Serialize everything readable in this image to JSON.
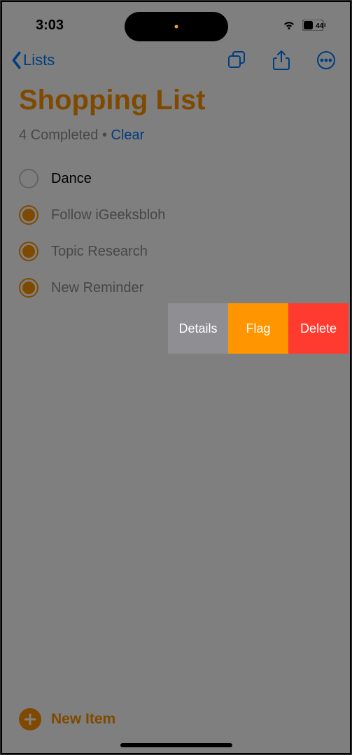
{
  "status": {
    "time": "3:03",
    "battery_text": "44"
  },
  "nav": {
    "back_label": "Lists"
  },
  "title": "Shopping List",
  "completed": {
    "prefix": "4 Completed",
    "separator": " • ",
    "clear_label": "Clear"
  },
  "items": [
    {
      "label": "Dance",
      "completed": false
    },
    {
      "label": "Follow iGeeksbloh",
      "completed": true
    },
    {
      "label": "Topic Research",
      "completed": true
    },
    {
      "label": "New Reminder",
      "completed": true
    }
  ],
  "swipe": {
    "details": "Details",
    "flag": "Flag",
    "delete": "Delete"
  },
  "footer": {
    "new_item": "New Item"
  }
}
